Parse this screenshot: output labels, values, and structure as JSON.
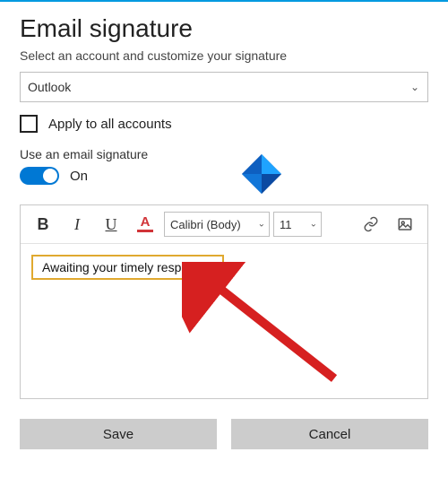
{
  "title": "Email signature",
  "subtitle": "Select an account and customize your signature",
  "account": {
    "selected": "Outlook"
  },
  "apply_all": {
    "label": "Apply to all accounts",
    "checked": false
  },
  "use_signature": {
    "label": "Use an email signature",
    "state_label": "On",
    "on": true
  },
  "toolbar": {
    "bold": "B",
    "italic": "I",
    "underline": "U",
    "fontcolor": "A",
    "font_family": "Calibri (Body)",
    "font_size": "11"
  },
  "signature_text": "Awaiting your timely response!",
  "buttons": {
    "save": "Save",
    "cancel": "Cancel"
  }
}
